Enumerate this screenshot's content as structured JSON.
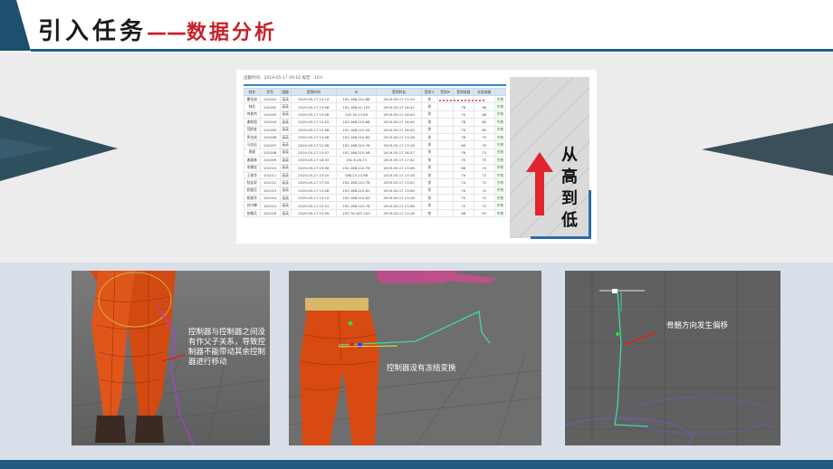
{
  "slide": {
    "title": "引入任务",
    "title_dash": "——",
    "title_sub": "数据分析",
    "colors": {
      "navy": "#215a83",
      "red": "#c8202b",
      "accent_teal": "#1d4f6e"
    }
  },
  "table": {
    "caption": "出勤时间：2019-05-17 09:10  规定：10人",
    "headers": [
      "姓名",
      "学号",
      "班级",
      "签到时间",
      "IP",
      "签到时长",
      "签到人",
      "签到IP",
      "签到成绩",
      "实验成绩",
      ""
    ],
    "rows": [
      [
        "曹金成",
        "101001",
        "英英",
        "2019-05-17 13:10",
        "192.168.210.88",
        "2019-05-17 13:10",
        "徐",
        "",
        "",
        "",
        "合格"
      ],
      [
        "林志",
        "101002",
        "英英",
        "2019-05-17 13:08",
        "192.168.41.193",
        "2019-05-17 16:42",
        "徐",
        "",
        "76",
        "86",
        "合格"
      ],
      [
        "何俊杰",
        "101003",
        "英英",
        "2019-05-17 13:08",
        "192.35.13.85",
        "2019-05-17 16:40",
        "徐",
        "",
        "70",
        "86",
        "合格"
      ],
      [
        "谢和祖",
        "101004",
        "英英",
        "2019-05-17 12:52",
        "192.168.210.68",
        "2019-05-17 16:40",
        "徐",
        "",
        "76",
        "80",
        "合格"
      ],
      [
        "范欧宜",
        "101005",
        "英英",
        "2019-05-17 12:58",
        "192.168.210.54",
        "2019-05-17 16:40",
        "徐",
        "",
        "70",
        "85",
        "合格"
      ],
      [
        "罗志成",
        "101006",
        "英英",
        "2019-05-17 13:08",
        "192.168.210.85",
        "2019-05-17 13:18",
        "徐",
        "",
        "76",
        "75",
        "合格"
      ],
      [
        "马志远",
        "101007",
        "英英",
        "2019-05-17 12:58",
        "192.168.210.76",
        "2019-05-17 13:18",
        "徐",
        "",
        "60",
        "75",
        "合格"
      ],
      [
        "周顺",
        "101008",
        "英英",
        "2019-05-17 13:07",
        "192.168.210.58",
        "2019-05-17 16:27",
        "徐",
        "",
        "76",
        "73",
        "合格"
      ],
      [
        "谢展林",
        "101009",
        "英英",
        "2019-05-17 16:43",
        "192.6.16.73",
        "2019-05-17 17:02",
        "徐",
        "",
        "70",
        "75",
        "合格"
      ],
      [
        "李建宏",
        "101010",
        "英英",
        "2019-05-17 13:08",
        "192.168.210.78",
        "2019-05-17 13:08",
        "徐",
        "",
        "66",
        "74",
        "合格"
      ],
      [
        "王振华",
        "101011",
        "英英",
        "2019-05-17 13:10",
        "188.23.21.66",
        "2019-05-17 13:18",
        "徐",
        "",
        "70",
        "72",
        "合格"
      ],
      [
        "陆佳豪",
        "101012",
        "英英",
        "2019-05-17 17:03",
        "192.168.210.78",
        "2019-05-17 13:20",
        "徐",
        "",
        "70",
        "72",
        "合格"
      ],
      [
        "欧展豆",
        "101013",
        "英英",
        "2019-05-17 13:08",
        "192.168.210.61",
        "2019-05-17 13:08",
        "徐",
        "",
        "70",
        "72",
        "合格"
      ],
      [
        "杨振华",
        "101014",
        "英英",
        "2019-05-17 13:10",
        "192.168.210.83",
        "2019-05-17 13:18",
        "徐",
        "",
        "70",
        "72",
        "合格"
      ],
      [
        "刘兴峰",
        "101015",
        "英英",
        "2019-05-17 12:51",
        "192.168.210.76",
        "2019-05-17 13:08",
        "徐",
        "",
        "70",
        "72",
        "合格"
      ],
      [
        "张敬兵",
        "101016",
        "英英",
        "2019-05-17 13:09",
        "192.76.167.203",
        "2019-05-17 13:18",
        "徐",
        "",
        "66",
        "67",
        "合格"
      ]
    ]
  },
  "sort_label": [
    "从",
    "高",
    "到",
    "低"
  ],
  "captions": {
    "shot1": "控制器与控制器之间没有作父子关系，导致控制器不能带动其余控制器进行移动",
    "shot2": "控制器没有冻结变换",
    "shot3": "骨骼方向发生偏移"
  }
}
